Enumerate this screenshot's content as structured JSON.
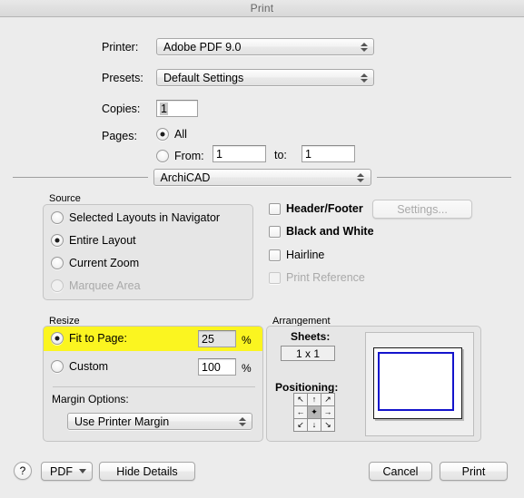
{
  "window": {
    "title": "Print"
  },
  "printer": {
    "label": "Printer:",
    "value": "Adobe PDF 9.0"
  },
  "presets": {
    "label": "Presets:",
    "value": "Default Settings"
  },
  "copies": {
    "label": "Copies:",
    "value": "1"
  },
  "pages": {
    "label": "Pages:",
    "all_label": "All",
    "from_label": "From:",
    "from_value": "1",
    "to_label": "to:",
    "to_value": "1"
  },
  "plugin_popup": {
    "value": "ArchiCAD"
  },
  "source": {
    "title": "Source",
    "options": [
      {
        "label": "Selected Layouts in Navigator",
        "selected": false,
        "disabled": false
      },
      {
        "label": "Entire Layout",
        "selected": true,
        "disabled": false
      },
      {
        "label": "Current Zoom",
        "selected": false,
        "disabled": false
      },
      {
        "label": "Marquee Area",
        "selected": false,
        "disabled": true
      }
    ]
  },
  "options": {
    "checkboxes": [
      {
        "label": "Header/Footer",
        "checked": false,
        "disabled": false
      },
      {
        "label": "Black and White",
        "checked": false,
        "disabled": false
      },
      {
        "label": "Hairline",
        "checked": false,
        "disabled": false
      },
      {
        "label": "Print Reference",
        "checked": false,
        "disabled": true
      }
    ],
    "settings_button": "Settings..."
  },
  "resize": {
    "title": "Resize",
    "fit_to_page_label": "Fit to Page:",
    "fit_to_page_value": "25",
    "fit_to_page_unit": "%",
    "fit_to_page_selected": true,
    "fit_to_page_highlight_color": "#fbf520",
    "custom_label": "Custom",
    "custom_value": "100",
    "custom_unit": "%",
    "custom_selected": false,
    "margin_options_label": "Margin Options:",
    "margin_options_value": "Use Printer Margin"
  },
  "arrangement": {
    "title": "Arrangement",
    "sheets_label": "Sheets:",
    "sheets_value": "1 x 1",
    "positioning_label": "Positioning:",
    "positioning_cells": [
      {
        "name": "top-left",
        "glyph": "↖",
        "selected": false
      },
      {
        "name": "top-center",
        "glyph": "↑",
        "selected": false
      },
      {
        "name": "top-right",
        "glyph": "↗",
        "selected": false
      },
      {
        "name": "middle-left",
        "glyph": "←",
        "selected": false
      },
      {
        "name": "center",
        "glyph": "✦",
        "selected": true
      },
      {
        "name": "middle-right",
        "glyph": "→",
        "selected": false
      },
      {
        "name": "bottom-left",
        "glyph": "↙",
        "selected": false
      },
      {
        "name": "bottom-center",
        "glyph": "↓",
        "selected": false
      },
      {
        "name": "bottom-right",
        "glyph": "↘",
        "selected": false
      }
    ],
    "preview_page_border_color": "#1414cc"
  },
  "footer": {
    "help_label": "?",
    "pdf_label": "PDF",
    "hide_details_label": "Hide Details",
    "cancel_label": "Cancel",
    "print_label": "Print"
  }
}
